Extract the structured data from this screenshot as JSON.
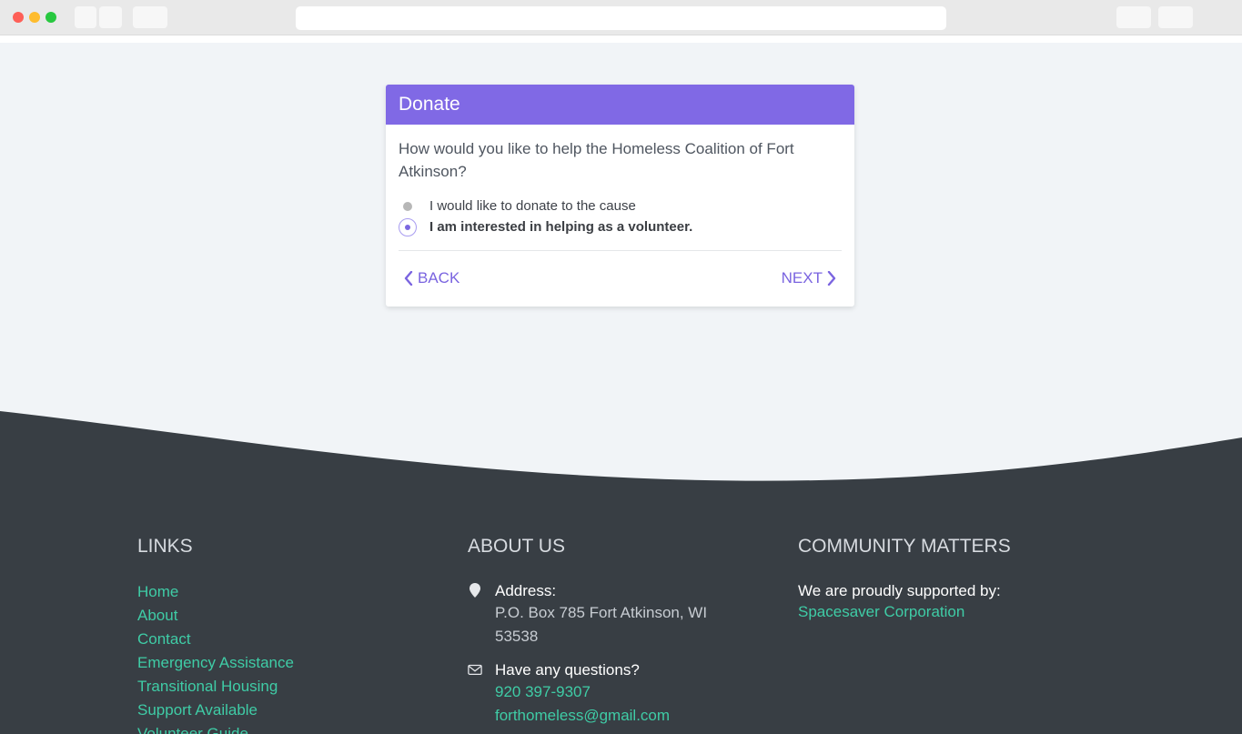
{
  "donate": {
    "title": "Donate",
    "question": "How would you like to help the Homeless Coalition of Fort Atkinson?",
    "options": [
      {
        "label": "I would like to donate to the cause",
        "selected": false
      },
      {
        "label": "I am interested in helping as a volunteer.",
        "selected": true
      }
    ],
    "back_label": "BACK",
    "next_label": "NEXT"
  },
  "footer": {
    "links": {
      "title": "LINKS",
      "items": [
        "Home",
        "About",
        "Contact",
        "Emergency Assistance",
        "Transitional Housing",
        "Support Available",
        "Volunteer Guide"
      ]
    },
    "about": {
      "title": "ABOUT US",
      "address_label": "Address:",
      "address": "P.O. Box 785 Fort Atkinson, WI 53538",
      "questions_label": "Have any questions?",
      "phone": "920 397-9307",
      "email": "forthomeless@gmail.com"
    },
    "community": {
      "title": "COMMUNITY MATTERS",
      "supported_label": "We are proudly supported by:",
      "sponsor": "Spacesaver Corporation"
    }
  },
  "colors": {
    "accent": "#8069e5",
    "footer_bg": "#383e44",
    "link": "#3fcca6"
  }
}
